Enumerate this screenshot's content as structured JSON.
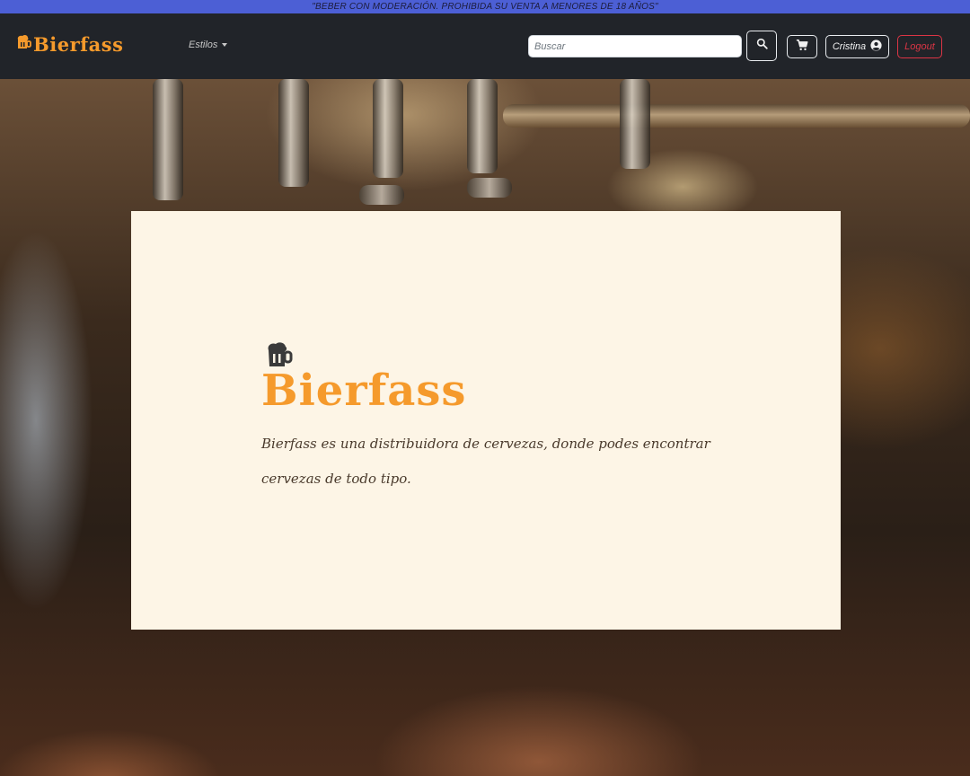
{
  "top_banner": {
    "text": "\"BEBER CON MODERACIÓN. PROHIBIDA SU VENTA A MENORES DE 18 AÑOS\""
  },
  "navbar": {
    "brand": "Bierfass",
    "dropdown_label": "Estilos",
    "search": {
      "placeholder": "Buscar",
      "value": ""
    },
    "search_icon": "search-icon",
    "cart_icon": "cart-icon",
    "user_label": "Cristina",
    "user_icon": "user-circle-icon",
    "logout_label": "Logout"
  },
  "hero": {
    "logo_text": "Bierfass",
    "description": "Bierfass es una distribuidora de cervezas, donde podes encontrar cervezas de todo tipo."
  },
  "colors": {
    "banner": "#4c5fd5",
    "navbar": "#212429",
    "accent": "#f59a2c",
    "card": "#fdf5e6",
    "logout": "#dc3545"
  }
}
